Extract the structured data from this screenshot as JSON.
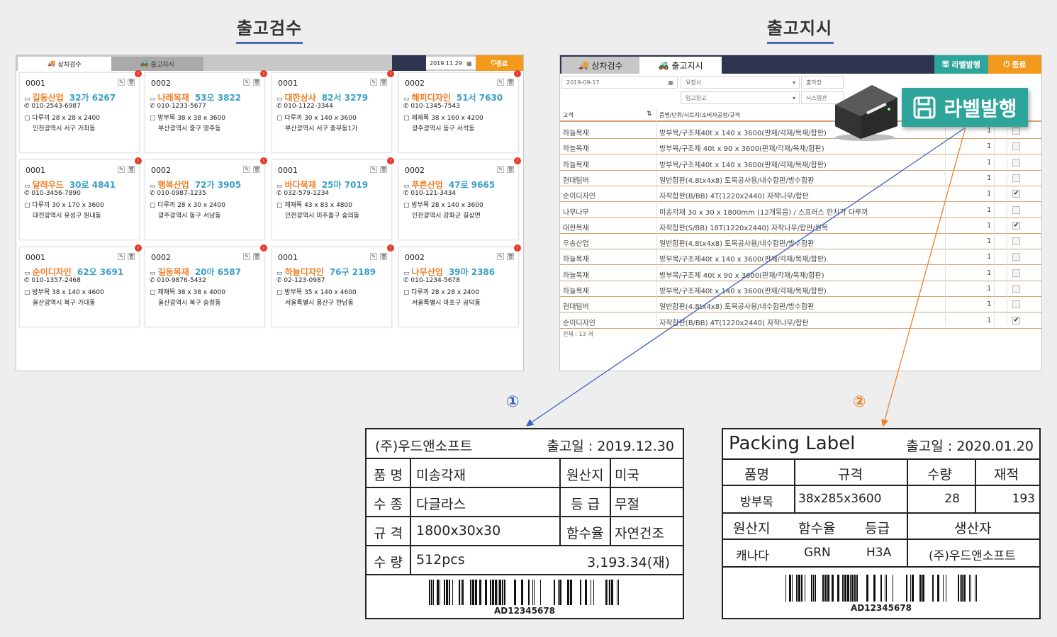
{
  "left_section": {
    "title": "출고검수"
  },
  "right_section": {
    "title": "출고지시"
  },
  "left_app": {
    "tab_active": "상차검수",
    "tab_inactive": "출고지시",
    "date": "2019.11.29",
    "exit_label": "종료",
    "cards": [
      {
        "no": "0001",
        "name": "길동산업",
        "plate": "32가 6267",
        "phone": "010-2543-6987",
        "spec": "다루끼  28 x 28 x 2400",
        "addr": "인천광역시 서구 가좌동"
      },
      {
        "no": "0002",
        "name": "나래목재",
        "plate": "53오 3822",
        "phone": "010-1233-5677",
        "spec": "방부목  38 x 38 x 3600",
        "addr": "부산광역시 중구 영주동"
      },
      {
        "no": "0001",
        "name": "대한상사",
        "plate": "82서 3279",
        "phone": "010-1122-3344",
        "spec": "다루끼  30 x 140 x 3600",
        "addr": "부산광역시 서구 충무동1가"
      },
      {
        "no": "0002",
        "name": "해피디자인",
        "plate": "51서 7630",
        "phone": "010-1345-7543",
        "spec": "제재목  38 x 160 x 4200",
        "addr": "광주광역시 동구 서석동"
      },
      {
        "no": "0001",
        "name": "달래우드",
        "plate": "30로 4841",
        "phone": "010-3456-7890",
        "spec": "다루끼  30 x 170 x 3600",
        "addr": "대전광역시 유성구 원내동"
      },
      {
        "no": "0002",
        "name": "행복산업",
        "plate": "72가 3905",
        "phone": "010-0987-1235",
        "spec": "다루끼  28 x 30 x 2400",
        "addr": "광주광역시 동구 서남동"
      },
      {
        "no": "0001",
        "name": "바다목재",
        "plate": "25마 7019",
        "phone": "032-579-1234",
        "spec": "제재목  43 x 83 x 4800",
        "addr": "인천광역시 미추홀구 숭의동"
      },
      {
        "no": "0002",
        "name": "푸른산업",
        "plate": "47로 9665",
        "phone": "010-121-3434",
        "spec": "방부목  28 x 140 x 3600",
        "addr": "인천광역시 강화군 길상면"
      },
      {
        "no": "0001",
        "name": "순이디자인",
        "plate": "62오 3691",
        "phone": "010-1357-2468",
        "spec": "방부목  38 x 140 x 4600",
        "addr": "울산광역시 북구 가대동"
      },
      {
        "no": "0002",
        "name": "길동목재",
        "plate": "20아 6587",
        "phone": "010-9876-5432",
        "spec": "제재목  38 x 38 x 4000",
        "addr": "울산광역시 북구 송정동"
      },
      {
        "no": "0001",
        "name": "하늘디자인",
        "plate": "76구 2189",
        "phone": "02-123-0987",
        "spec": "방부목  35 x 140 x 4600",
        "addr": "서울특별시 용산구 한남동"
      },
      {
        "no": "0002",
        "name": "나무산업",
        "plate": "39마 2386",
        "phone": "010-1234-5678",
        "spec": "다루끼  28 x 28 x 2400",
        "addr": "서울특별시 마포구 공덕동"
      }
    ]
  },
  "right_app": {
    "tab1": "상차검수",
    "tab2": "출고지시",
    "label_btn": "라벨발행",
    "exit_label": "종료",
    "filters": {
      "date": "2019-09-17",
      "req": "요청서",
      "ship": "출하장",
      "storage": "입고창고",
      "system": "시스템관"
    },
    "header": {
      "c1": "고객",
      "c2": "품명/단위/시트지/소비자공정/규격"
    },
    "rows": [
      {
        "c": "하늘목재",
        "d": "방부목/구조제40t x 140 x 3600(판재/각재/목재/합판)",
        "q": "1",
        "chk": false
      },
      {
        "c": "하늘목재",
        "d": "방부목/구조제 40t x 90 x 3600(판재/각재/목재/합판)",
        "q": "1",
        "chk": false
      },
      {
        "c": "하늘목재",
        "d": "방부목/구조제40t x 140 x 3600(판재/각재/목재/합판)",
        "q": "1",
        "chk": false
      },
      {
        "c": "현대팀버",
        "d": "일반합판(4.8tx4x8) 토목공사용/내수합판/방수합판",
        "q": "1",
        "chk": false
      },
      {
        "c": "순이디자인",
        "d": "자작합판(B/BB) 4T(1220x2440) 자작나무/합판",
        "q": "1",
        "chk": true
      },
      {
        "c": "나무나무",
        "d": "미송각재 30 x 30 x 1800mm (12개묶음) / 스프러스 한치각 다루끼",
        "q": "1",
        "chk": false
      },
      {
        "c": "대한목재",
        "d": "자작합판(S/BB) 18T(1220x2440) 자작나무/합판/원목",
        "q": "1",
        "chk": true
      },
      {
        "c": "우송산업",
        "d": "일반합판(4.8tx4x8) 토목공사용/내수합판/방수합판",
        "q": "1",
        "chk": false
      },
      {
        "c": "하늘목재",
        "d": "방부목/구조제40t x 140 x 3600(판재/각재/목재/합판)",
        "q": "1",
        "chk": false
      },
      {
        "c": "하늘목재",
        "d": "방부목/구조제 40t x 90 x 3600(판재/각재/목재/합판)",
        "q": "1",
        "chk": false
      },
      {
        "c": "하늘목재",
        "d": "방부목/구조제40t x 140 x 3600(판재/각재/목재/합판)",
        "q": "1",
        "chk": false
      },
      {
        "c": "현대팀버",
        "d": "일반합판(4.8tx4x8) 토목공사용/내수합판/방수합판",
        "q": "1",
        "chk": false
      },
      {
        "c": "순이디자인",
        "d": "자작합판(B/BB) 4T(1220x2440) 자작나무/합판",
        "q": "1",
        "chk": true
      }
    ],
    "total": "전체 : 13 개",
    "big_button": "라벨발행"
  },
  "label1": {
    "marker": "①",
    "company": "(주)우드앤소프트",
    "date": "출고일 : 2019.12.30",
    "k1": "품 명",
    "v1": "미송각재",
    "k2": "원산지",
    "v2": "미국",
    "k3": "수 종",
    "v3": "다글라스",
    "k4": "등 급",
    "v4": "무절",
    "k5": "규 격",
    "v5": "1800x30x30",
    "k6": "함수율",
    "v6": "자연건조",
    "k7": "수 량",
    "v7": "512pcs",
    "v8": "3,193.34(재)",
    "barcode": "AD12345678"
  },
  "label2": {
    "marker": "②",
    "title": "Packing Label",
    "date": "출고일 : 2020.01.20",
    "h1": "품명",
    "h2": "규격",
    "h3": "수량",
    "h4": "재적",
    "v1": "방부목",
    "v2": "38x285x3600",
    "v3": "28",
    "v4": "193",
    "h5": "원산지",
    "h6": "함수율",
    "h7": "등급",
    "h8": "생산자",
    "v5": "캐나다",
    "v6": "GRN",
    "v7": "H3A",
    "v8": "(주)우드앤소프트",
    "barcode": "AD12345678"
  },
  "colors": {
    "accent_blue": "#4a6fb5",
    "orange": "#f39a1c",
    "teal": "#2da59a",
    "navy": "#2f3550"
  }
}
